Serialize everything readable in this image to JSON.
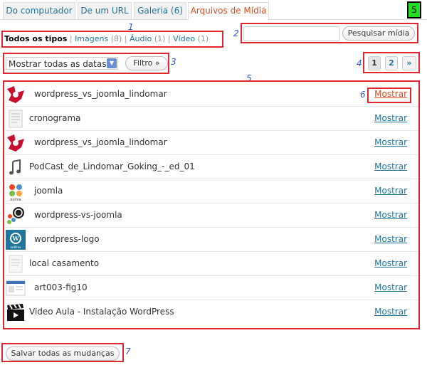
{
  "tabs": [
    {
      "label": "Do computador"
    },
    {
      "label": "De um URL"
    },
    {
      "label": "Galeria (6)"
    },
    {
      "label": "Arquivos de Mídia",
      "active": true
    }
  ],
  "annotations": {
    "n1": "1",
    "n2": "2",
    "n3": "3",
    "n4": "4",
    "n5": "5",
    "n6": "6",
    "n7": "7",
    "n5box": "5"
  },
  "filters": [
    {
      "label": "Todos os tipos",
      "count": "",
      "current": true
    },
    {
      "label": "Imagens",
      "count": "(8)"
    },
    {
      "label": "Áudio",
      "count": "(1)"
    },
    {
      "label": "Vídeo",
      "count": "(1)"
    }
  ],
  "search": {
    "placeholder": "",
    "button": "Pesquisar mídia"
  },
  "date_filter": {
    "selected": "Mostrar todas as datas",
    "button": "Filtro »"
  },
  "pagination": {
    "pages": [
      "1",
      "2"
    ],
    "next": "»",
    "current": "1"
  },
  "media": [
    {
      "title": "wordpress_vs_joomla_lindomar",
      "action": "Mostrar",
      "icon": "wp-vs-joomla-thumbnail-icon"
    },
    {
      "title": "cronograma",
      "action": "Mostrar",
      "icon": "document-thumbnail-icon"
    },
    {
      "title": "wordpress_vs_joomla_lindomar",
      "action": "Mostrar",
      "icon": "wp-vs-joomla-thumbnail-icon"
    },
    {
      "title": "PodCast_de_Lindomar_Goking_-_ed_01",
      "action": "Mostrar",
      "icon": "audio-file-icon"
    },
    {
      "title": "joomla",
      "action": "Mostrar",
      "icon": "joomla-logo-icon"
    },
    {
      "title": "wordpress-vs-joomla",
      "action": "Mostrar",
      "icon": "wp-joomla-logo-icon"
    },
    {
      "title": "wordpress-logo",
      "action": "Mostrar",
      "icon": "wordpress-logo-icon"
    },
    {
      "title": "local casamento",
      "action": "Mostrar",
      "icon": "document-thumbnail-icon"
    },
    {
      "title": "art003-fig10",
      "action": "Mostrar",
      "icon": "screenshot-thumbnail-icon"
    },
    {
      "title": "Video Aula - Instalação WordPress",
      "action": "Mostrar",
      "icon": "video-clapper-icon"
    }
  ],
  "save_button": "Salvar todas as mudanças",
  "colors": {
    "link": "#21759b",
    "active_tab": "#d54e21",
    "annotation_box": "#e0262e",
    "annotation_number": "#2e5bd6",
    "green_marker": "#22dd22"
  }
}
